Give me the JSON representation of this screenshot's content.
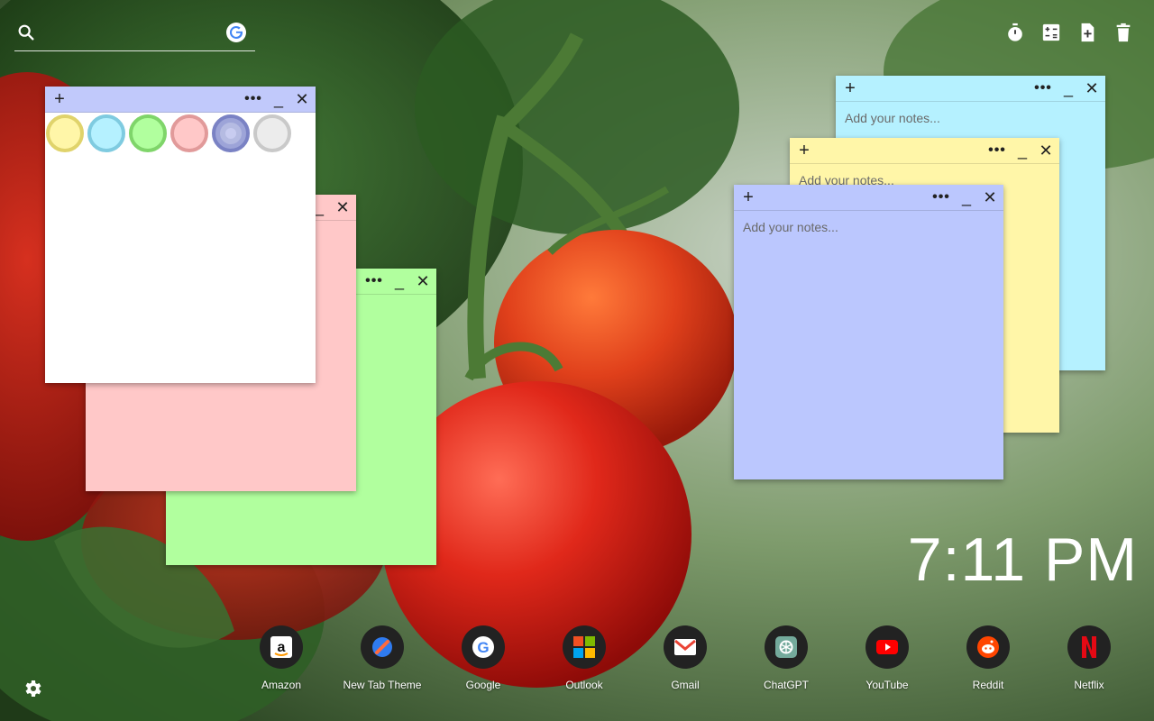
{
  "search": {
    "placeholder": ""
  },
  "toolbar": {
    "items": [
      {
        "icon": "timer-icon"
      },
      {
        "icon": "calculator-icon"
      },
      {
        "icon": "new-note-icon"
      },
      {
        "icon": "trash-icon"
      }
    ]
  },
  "notes": {
    "controls": {
      "add": "+",
      "more": "•••",
      "minimize": "_",
      "close": "✕"
    },
    "placeholder": "Add your notes...",
    "palette": [
      {
        "color": "#fff6a8",
        "border": "#e0d36b"
      },
      {
        "color": "#b5f1ff",
        "border": "#7fcbe0"
      },
      {
        "color": "#b1ff9e",
        "border": "#7fd56a"
      },
      {
        "color": "#ffc8c8",
        "border": "#e19a9a"
      },
      {
        "color": "#9da4d8",
        "border": "#7a82c4"
      },
      {
        "color": "#ececec",
        "border": "#c9c9c9"
      }
    ],
    "colors": {
      "white": "#ffffff",
      "pink": "#ffc8c8",
      "green": "#b1ff9e",
      "cyan": "#b5f1ff",
      "yellow": "#fff6a8",
      "blue": "#bbc7fe",
      "header_white": "#c1c9fb"
    }
  },
  "clock": {
    "time": "7:11 PM"
  },
  "dock": {
    "apps": [
      {
        "label": "Amazon",
        "icon": "amazon-icon"
      },
      {
        "label": "New Tab Theme",
        "icon": "new-tab-theme-icon"
      },
      {
        "label": "Google",
        "icon": "google-icon"
      },
      {
        "label": "Outlook",
        "icon": "outlook-icon"
      },
      {
        "label": "Gmail",
        "icon": "gmail-icon"
      },
      {
        "label": "ChatGPT",
        "icon": "chatgpt-icon"
      },
      {
        "label": "YouTube",
        "icon": "youtube-icon"
      },
      {
        "label": "Reddit",
        "icon": "reddit-icon"
      },
      {
        "label": "Netflix",
        "icon": "netflix-icon"
      }
    ]
  },
  "settings": {
    "icon": "gear-icon"
  }
}
